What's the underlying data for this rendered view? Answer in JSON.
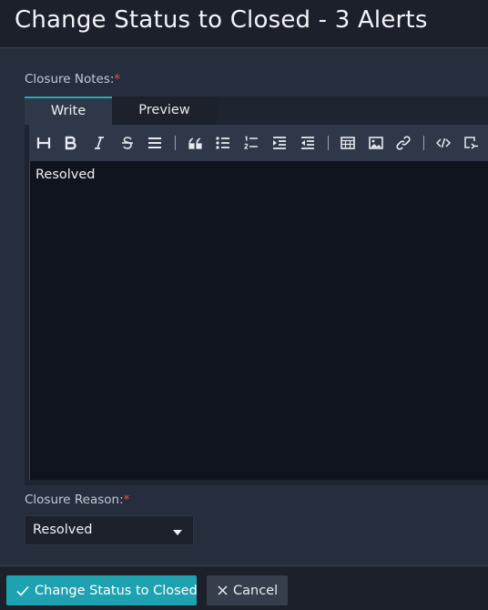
{
  "dialog": {
    "title": "Change Status to Closed - 3 Alerts"
  },
  "closure_notes": {
    "label": "Closure Notes:",
    "required_mark": "*",
    "tabs": {
      "write": "Write",
      "preview": "Preview"
    },
    "content": "Resolved"
  },
  "toolbar": {
    "icons": [
      "heading-icon",
      "bold-icon",
      "italic-icon",
      "strikethrough-icon",
      "align-icon",
      "quote-icon",
      "unordered-list-icon",
      "ordered-list-icon",
      "indent-icon",
      "outdent-icon",
      "table-icon",
      "image-icon",
      "link-icon",
      "code-icon",
      "embed-icon"
    ]
  },
  "closure_reason": {
    "label": "Closure Reason:",
    "required_mark": "*",
    "selected": "Resolved"
  },
  "footer": {
    "primary_label": "Change Status to Closed",
    "cancel_label": "Cancel"
  },
  "colors": {
    "accent": "#1fa2b0",
    "required": "#e0524e",
    "background": "#262d3c",
    "editor_bg": "#0f141d"
  }
}
